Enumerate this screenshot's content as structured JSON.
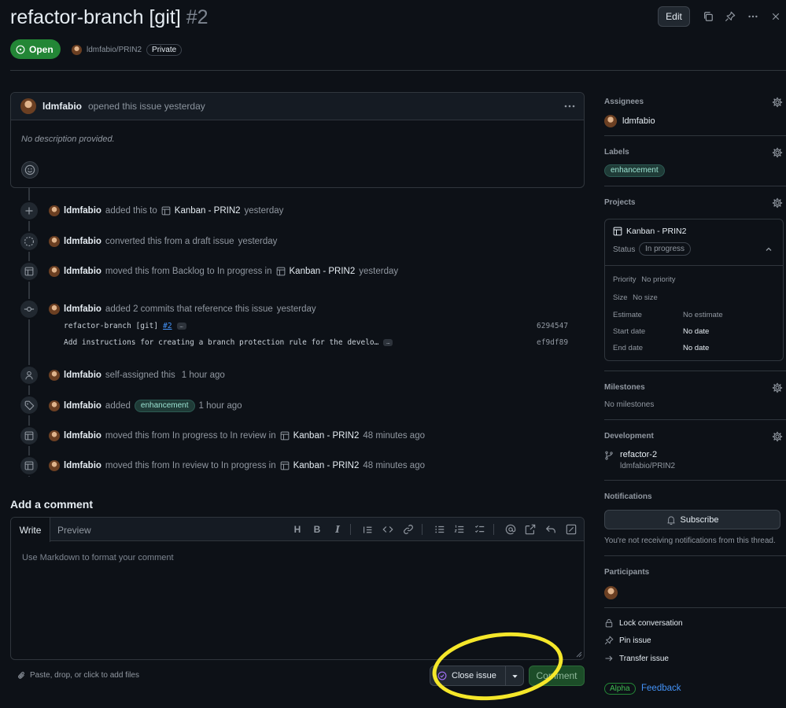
{
  "issue": {
    "title": "refactor-branch [git]",
    "number": "#2",
    "state": "Open",
    "repo": "ldmfabio/PRIN2",
    "visibility": "Private"
  },
  "header": {
    "edit_label": "Edit"
  },
  "comment": {
    "author": "ldmfabio",
    "action": "opened this issue yesterday",
    "body_placeholder": "No description provided."
  },
  "timeline": {
    "e1": {
      "author": "ldmfabio",
      "text": "added this to",
      "project": "Kanban - PRIN2",
      "time": "yesterday"
    },
    "e2": {
      "author": "ldmfabio",
      "text": "converted this from a draft issue",
      "time": "yesterday"
    },
    "e3": {
      "author": "ldmfabio",
      "text": "moved this from Backlog to In progress in",
      "project": "Kanban - PRIN2",
      "time": "yesterday"
    },
    "e4": {
      "author": "ldmfabio",
      "text": "added 2 commits that reference this issue",
      "time": "yesterday",
      "commits": [
        {
          "message": "refactor-branch [git]",
          "ref": "#2",
          "sha": "6294547"
        },
        {
          "message": "Add instructions for creating a branch protection rule for the develo…",
          "sha": "ef9df89"
        }
      ]
    },
    "e5": {
      "author": "ldmfabio",
      "text": "self-assigned this",
      "time": "1 hour ago"
    },
    "e6": {
      "author": "ldmfabio",
      "text": "added",
      "label": "enhancement",
      "time": "1 hour ago"
    },
    "e7": {
      "author": "ldmfabio",
      "text": "moved this from In progress to In review in",
      "project": "Kanban - PRIN2",
      "time": "48 minutes ago"
    },
    "e8": {
      "author": "ldmfabio",
      "text": "moved this from In review to In progress in",
      "project": "Kanban - PRIN2",
      "time": "48 minutes ago"
    }
  },
  "composer": {
    "title": "Add a comment",
    "tab_write": "Write",
    "tab_preview": "Preview",
    "placeholder": "Use Markdown to format your comment",
    "attach_label": "Paste, drop, or click to add files",
    "close_label": "Close issue",
    "comment_label": "Comment"
  },
  "sidebar": {
    "assignees": {
      "title": "Assignees",
      "value": "ldmfabio"
    },
    "labels": {
      "title": "Labels",
      "value": "enhancement"
    },
    "projects": {
      "title": "Projects",
      "name": "Kanban - PRIN2",
      "status_label": "Status",
      "status_value": "In progress",
      "fields": {
        "priority": {
          "label": "Priority",
          "value": "No priority"
        },
        "size": {
          "label": "Size",
          "value": "No size"
        },
        "estimate": {
          "label": "Estimate",
          "value": "No estimate"
        },
        "start": {
          "label": "Start date",
          "value": "No date"
        },
        "end": {
          "label": "End date",
          "value": "No date"
        }
      }
    },
    "milestones": {
      "title": "Milestones",
      "value": "No milestones"
    },
    "development": {
      "title": "Development",
      "branch": "refactor-2",
      "repo": "ldmfabio/PRIN2"
    },
    "notifications": {
      "title": "Notifications",
      "button": "Subscribe",
      "note": "You're not receiving notifications from this thread."
    },
    "participants": {
      "title": "Participants"
    },
    "actions": {
      "lock": "Lock conversation",
      "pin": "Pin issue",
      "transfer": "Transfer issue"
    },
    "alpha": "Alpha",
    "feedback": "Feedback"
  },
  "colors": {
    "open": "#238636",
    "link": "#4493f8",
    "highlight": "#f5e72a",
    "background": "#0d1117"
  }
}
